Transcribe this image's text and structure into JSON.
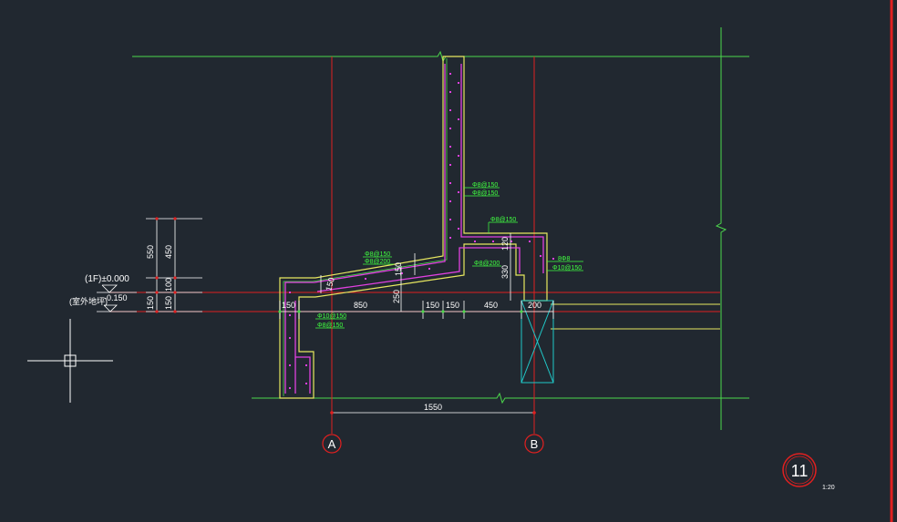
{
  "drawing": {
    "colors": {
      "background": "#212830",
      "axis": "#e02020",
      "outline": "#4cd84c",
      "concrete": "#e8e860",
      "rebar": "#e040e0",
      "dimension": "#ffffff",
      "rebar_note": "#40ff40",
      "pile": "#20c8c8",
      "border": "#e02020"
    },
    "level_labels": {
      "floor": "(1F)±0.000",
      "ground": "(室外地坪)",
      "ground_value": "-0.150"
    },
    "vertical_dims": {
      "d550": "550",
      "d450": "450",
      "d100": "100",
      "d150a": "150",
      "d150b": "150",
      "d150c": "150",
      "d250": "250",
      "d150d": "150",
      "d120": "120",
      "d330": "330"
    },
    "horizontal_dims": {
      "d150": "150",
      "d850": "850",
      "d150a": "150",
      "d150b": "150",
      "d450": "450",
      "d200": "200",
      "d1550": "1550"
    },
    "rebar_notes": {
      "n1": "Φ8@150",
      "n2": "Φ8@150",
      "n3": "Φ8@150",
      "n4": "Φ8@150",
      "n5": "Φ8@200",
      "n6": "Φ8@200",
      "n7": "Φ10@150",
      "n8": "Φ8@150",
      "n9": "8Φ8",
      "n10": "Φ10@150"
    },
    "axis_labels": {
      "a": "A",
      "b": "B"
    },
    "detail": {
      "number": "11",
      "scale": "1:20"
    }
  }
}
